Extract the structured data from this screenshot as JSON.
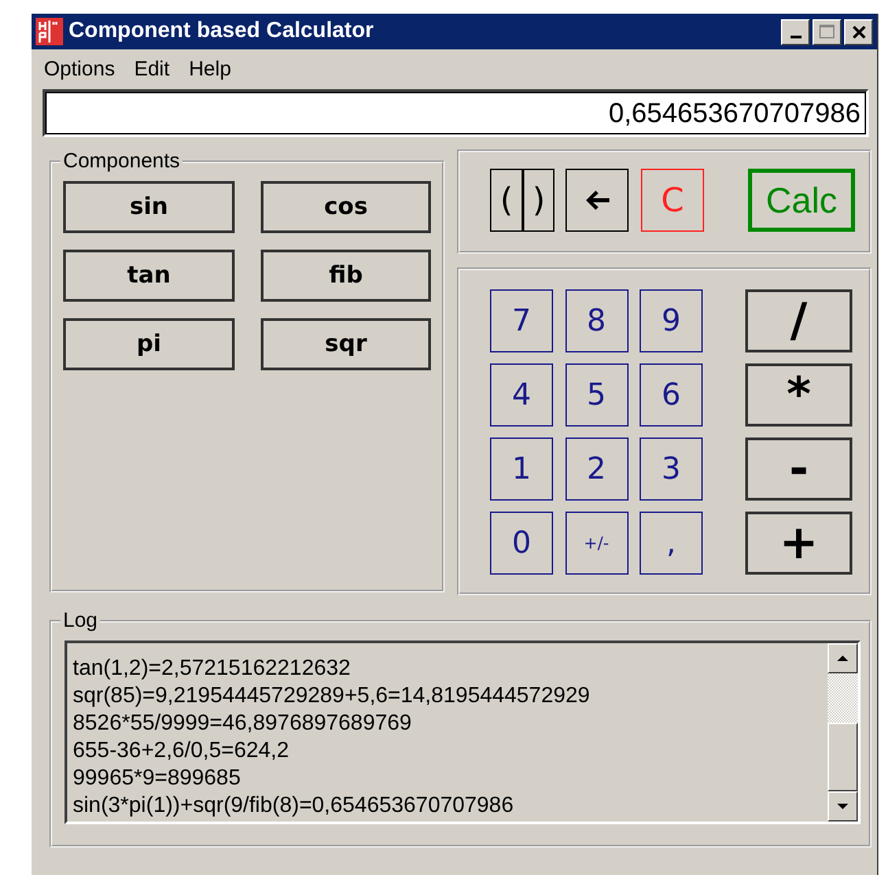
{
  "window": {
    "title": "Component based Calculator"
  },
  "menu": [
    "Options",
    "Edit",
    "Help"
  ],
  "display": {
    "value": "0,654653670707986"
  },
  "components": {
    "label": "Components",
    "buttons": [
      "sin",
      "cos",
      "tan",
      "fib",
      "pi",
      "sqr"
    ]
  },
  "controls": [
    {
      "kind": "brackets",
      "labels": [
        "(",
        ")"
      ]
    },
    {
      "kind": "backspace"
    },
    {
      "kind": "clear",
      "label": "C"
    },
    {
      "kind": "calc",
      "label": "Calc"
    }
  ],
  "keypad": {
    "digits": [
      "7",
      "8",
      "9",
      "4",
      "5",
      "6",
      "1",
      "2",
      "3",
      "0",
      "+/-",
      ","
    ],
    "operators": [
      "/",
      "*",
      "-",
      "+"
    ]
  },
  "log": {
    "label": "Log",
    "lines": [
      "tan(1,2)=2,57215162212632",
      "sqr(85)=9,21954445729289+5,6=14,8195444572929",
      "8526*55/9999=46,8976897689769",
      "655-36+2,6/0,5=624,2",
      "99965*9=899685",
      "sin(3*pi(1))+sqr(9/fib(8)=0,654653670707986"
    ]
  }
}
